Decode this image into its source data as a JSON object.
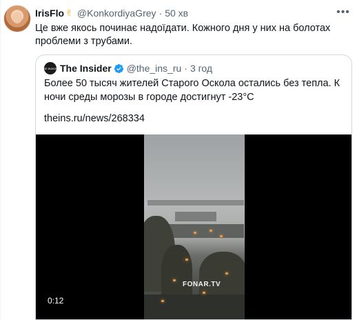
{
  "tweet": {
    "name": "IrisFlo",
    "emoji": "✌",
    "handle": "@KonkordiyaGrey",
    "dot": "·",
    "time": "50 хв",
    "text": "Це вже якось починає надоїдати. Кожного дня у них на болотах проблеми з трубами."
  },
  "quote": {
    "avatar_label": "THE INSIDER",
    "name": "The Insider",
    "handle": "@the_ins_ru",
    "dot": "·",
    "time": "3 год",
    "text": "Более 50 тысяч жителей Старого Оскола остались без тепла. К ночи среды морозы в городе достигнут -23°C",
    "link": "theins.ru/news/268334",
    "video": {
      "watermark": "FONAR.TV",
      "duration": "0:12"
    }
  },
  "colors": {
    "text": "#0f1419",
    "secondary": "#536471",
    "verified": "#1d9bf0",
    "border": "#cfd9de"
  },
  "icons": {
    "more": "more-horizontal-icon",
    "verified": "verified-badge-icon"
  }
}
